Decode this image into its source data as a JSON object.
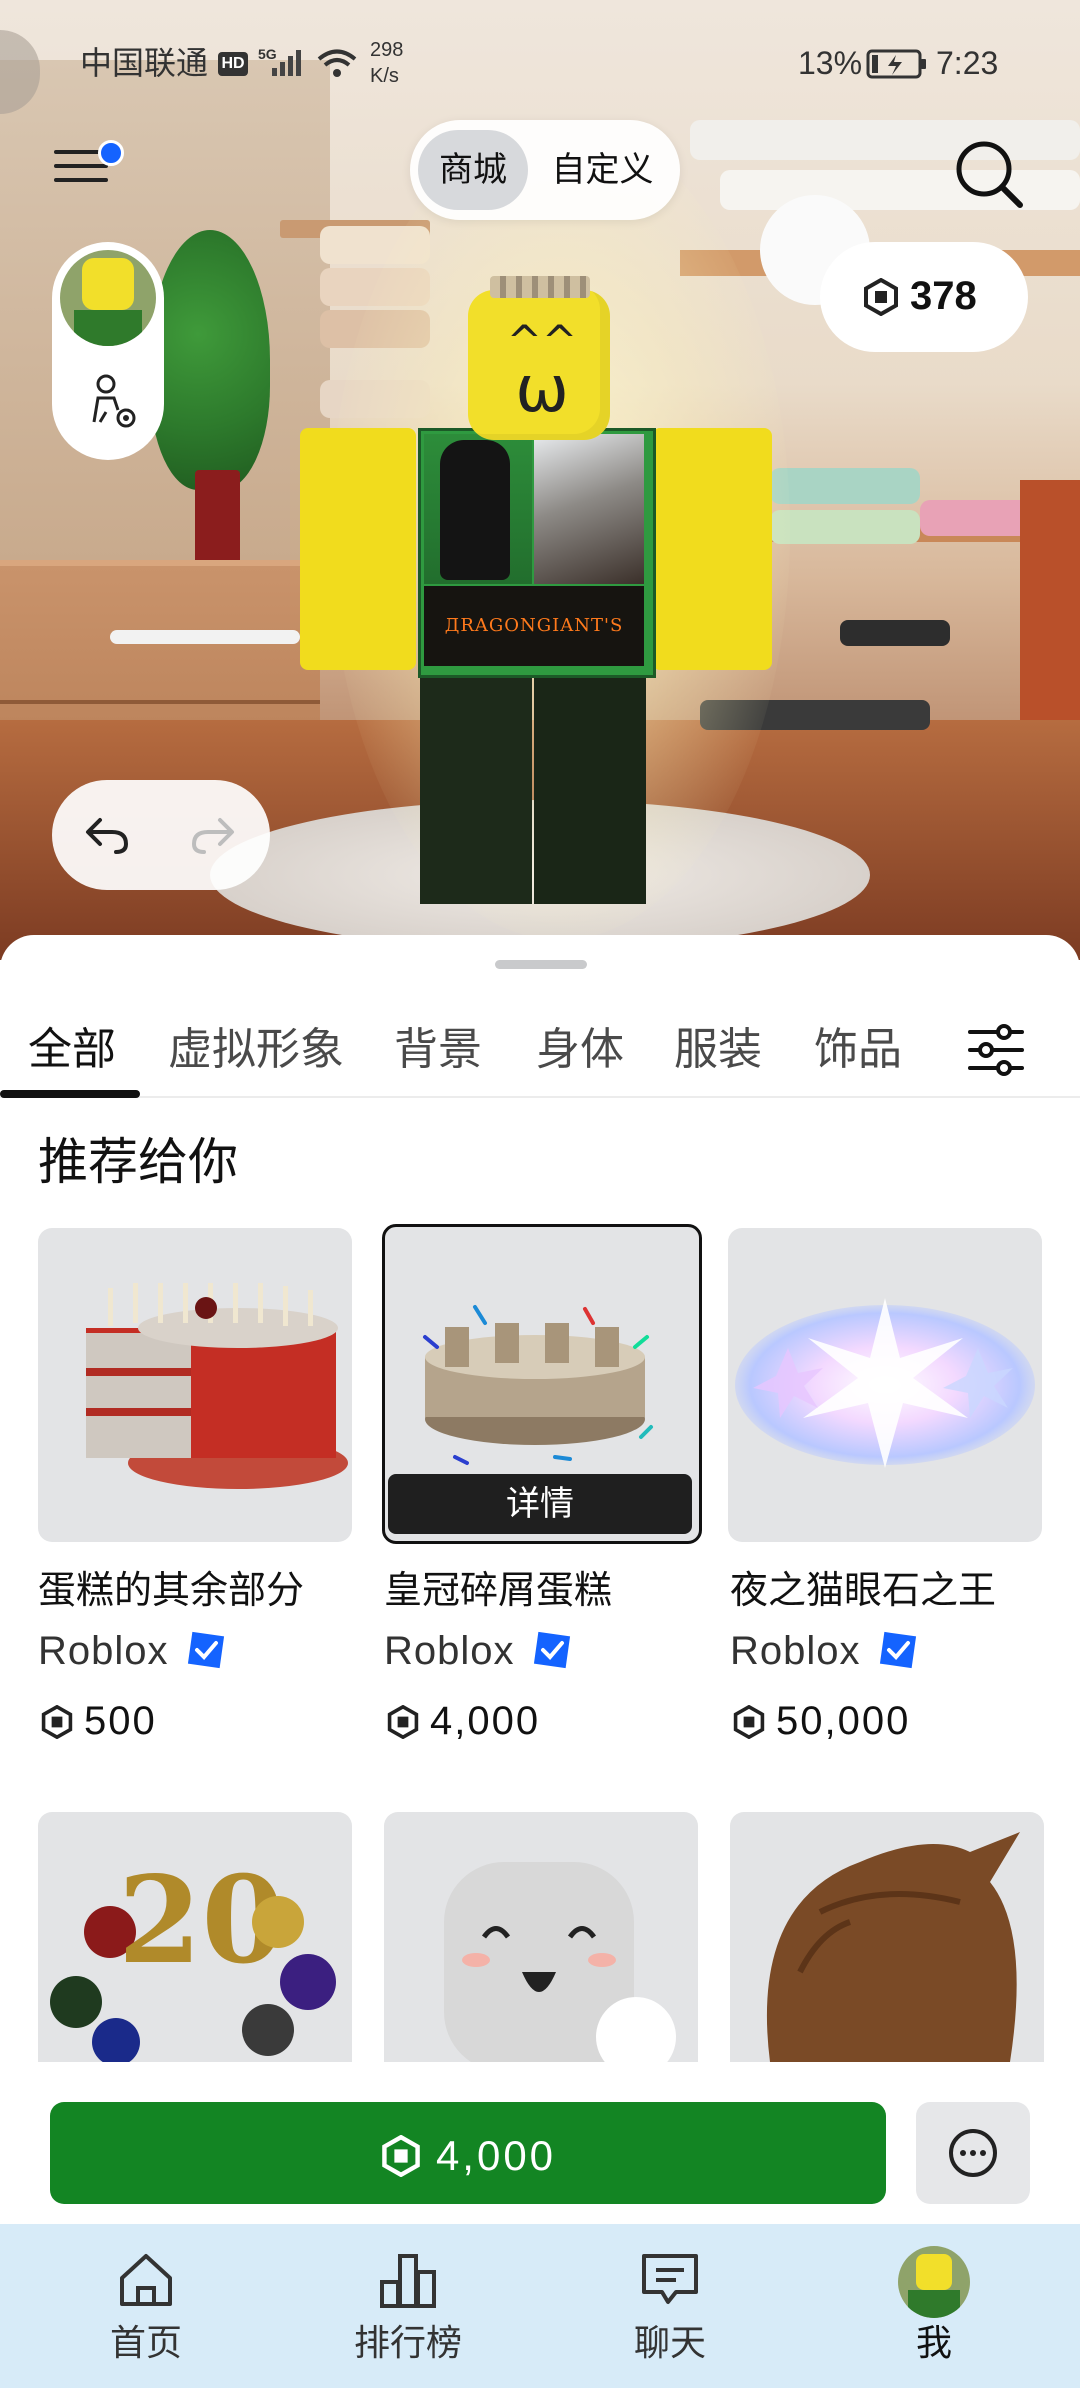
{
  "status_bar": {
    "carrier": "中国联通",
    "network_badge": "HD",
    "network_type": "5G",
    "speed_value": "298",
    "speed_unit": "K/s",
    "battery": "13%",
    "time": "7:23"
  },
  "header": {
    "segment_shop": "商城",
    "segment_custom": "自定义",
    "robux_balance": "378"
  },
  "avatar_scene": {
    "face": "^^\nω",
    "torso_text": "ДRAGONGIANT'S"
  },
  "tabs": [
    {
      "label": "全部",
      "active": true
    },
    {
      "label": "虚拟形象",
      "active": false
    },
    {
      "label": "背景",
      "active": false
    },
    {
      "label": "身体",
      "active": false
    },
    {
      "label": "服装",
      "active": false
    },
    {
      "label": "饰品",
      "active": false
    }
  ],
  "section": {
    "title": "推荐给你"
  },
  "items": [
    {
      "name": "蛋糕的其余部分",
      "creator": "Roblox",
      "price": "500"
    },
    {
      "name": "皇冠碎屑蛋糕",
      "creator": "Roblox",
      "price": "4,000",
      "details_label": "详情"
    },
    {
      "name": "夜之猫眼石之王",
      "creator": "Roblox",
      "price": "50,000"
    }
  ],
  "buy_bar": {
    "price": "4,000"
  },
  "bottom_nav": [
    {
      "label": "首页",
      "icon": "home-icon"
    },
    {
      "label": "排行榜",
      "icon": "leaderboard-icon"
    },
    {
      "label": "聊天",
      "icon": "chat-icon"
    },
    {
      "label": "我",
      "icon": "avatar-icon"
    }
  ],
  "colors": {
    "buy_green": "#138523",
    "verified_blue": "#1463ff",
    "nav_background": "#d7ebf8"
  }
}
